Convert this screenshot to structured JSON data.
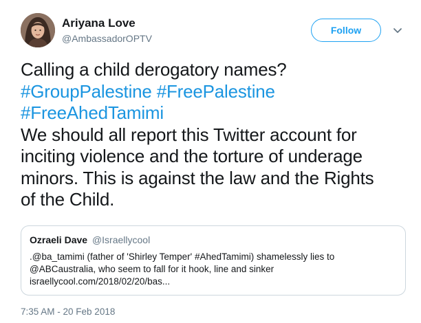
{
  "author": {
    "display_name": "Ariyana Love",
    "handle": "@AmbassadorOPTV"
  },
  "follow_button": {
    "label": "Follow"
  },
  "icons": {
    "menu": "chevron-down-icon",
    "avatar": "profile-photo"
  },
  "tweet": {
    "lines": [
      {
        "text": "Calling a child derogatory names?",
        "hashtags": []
      },
      {
        "text": "",
        "hashtags": [
          "#GroupPalestine",
          "#FreePalestine"
        ]
      },
      {
        "text": "",
        "hashtags": [
          "#FreeAhedTamimi"
        ]
      },
      {
        "text": "We should all report this Twitter account for",
        "hashtags": []
      },
      {
        "text": "inciting violence and the torture of underage",
        "hashtags": []
      },
      {
        "text": "minors. This is against the law and the Rights",
        "hashtags": []
      },
      {
        "text": "of the Child.",
        "hashtags": []
      }
    ],
    "timestamp": "7:35 AM - 20 Feb 2018"
  },
  "quoted_tweet": {
    "display_name": "Ozraeli Dave",
    "handle": "@Israellycool",
    "lines": [
      ".@ba_tamimi (father of 'Shirley Temper' #AhedTamimi) shamelessly lies to",
      "@ABCaustralia, who seem to fall for it hook, line and sinker",
      "israellycool.com/2018/02/20/bas..."
    ]
  },
  "colors": {
    "link_blue": "#1b95e0",
    "follow_blue": "#1da1f2",
    "secondary_gray": "#657786",
    "border_gray": "#ccd6dd",
    "text": "#14171a"
  }
}
